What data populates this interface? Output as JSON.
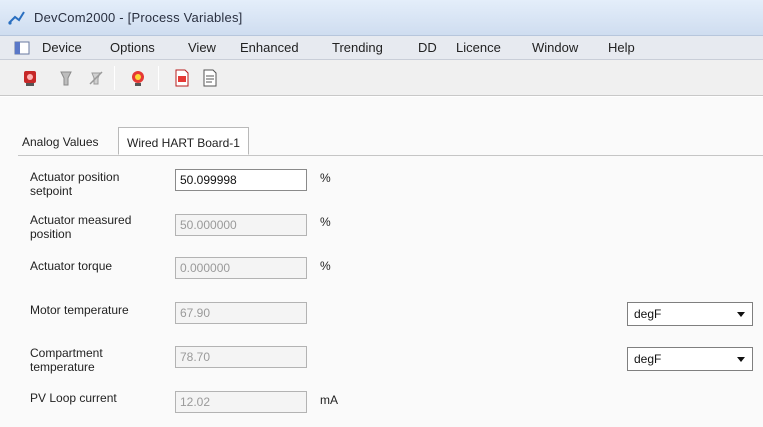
{
  "window": {
    "title": "DevCom2000 - [Process Variables]"
  },
  "menu": [
    "Device",
    "Options",
    "View",
    "Enhanced",
    "Trending",
    "DD",
    "Licence",
    "Window",
    "Help"
  ],
  "toolbar": {
    "icons": [
      "device-red-icon",
      "connect-icon",
      "disconnect-icon",
      "alarm-icon",
      "report-red-icon",
      "document-icon"
    ]
  },
  "tabs": [
    {
      "label": "Analog Values",
      "active": false
    },
    {
      "label": "Wired HART Board-1",
      "active": true
    }
  ],
  "fields": [
    {
      "label": "Actuator position setpoint",
      "value": "50.099998",
      "unit": "%",
      "editable": true
    },
    {
      "label": "Actuator measured position",
      "value": "50.000000",
      "unit": "%",
      "editable": false
    },
    {
      "label": "Actuator torque",
      "value": "0.000000",
      "unit": "%",
      "editable": false
    },
    {
      "label": "Motor temperature",
      "value": "67.90",
      "unit_select": "degF",
      "editable": false
    },
    {
      "label": "Compartment temperature",
      "value": "78.70",
      "unit_select": "degF",
      "editable": false
    },
    {
      "label": "PV Loop current",
      "value": "12.02",
      "unit": "mA",
      "editable": false
    }
  ]
}
